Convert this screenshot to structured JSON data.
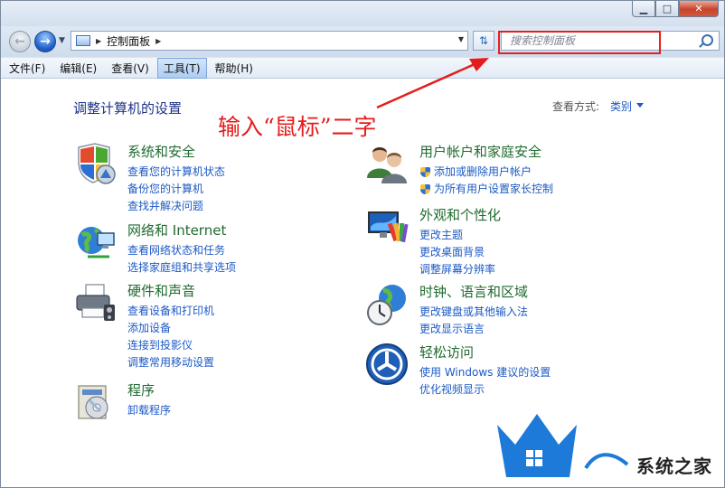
{
  "window": {
    "minimize_glyph": "▁",
    "maximize_glyph": "□",
    "close_glyph": "✕"
  },
  "address": {
    "crumb": "控制面板",
    "search_placeholder": "搜索控制面板"
  },
  "menu": {
    "items": [
      {
        "label": "文件(F)",
        "active": false
      },
      {
        "label": "编辑(E)",
        "active": false
      },
      {
        "label": "查看(V)",
        "active": false
      },
      {
        "label": "工具(T)",
        "active": true
      },
      {
        "label": "帮助(H)",
        "active": false
      }
    ]
  },
  "content": {
    "title": "调整计算机的设置",
    "view_by_label": "查看方式:",
    "view_by_value": "类别",
    "annotation": "输入“鼠标”二字"
  },
  "categories": {
    "system": {
      "icon": "shield-icon",
      "title": "系统和安全",
      "links": [
        "查看您的计算机状态",
        "备份您的计算机",
        "查找并解决问题"
      ]
    },
    "network": {
      "icon": "network-globe-icon",
      "title": "网络和 Internet",
      "links": [
        "查看网络状态和任务",
        "选择家庭组和共享选项"
      ]
    },
    "hardware": {
      "icon": "printer-icon",
      "title": "硬件和声音",
      "links": [
        "查看设备和打印机",
        "添加设备",
        "连接到投影仪",
        "调整常用移动设置"
      ]
    },
    "programs": {
      "icon": "programs-icon",
      "title": "程序",
      "links": [
        "卸载程序"
      ]
    },
    "users": {
      "icon": "users-icon",
      "title": "用户帐户和家庭安全",
      "links": [
        "添加或删除用户帐户",
        "为所有用户设置家长控制"
      ]
    },
    "appearance": {
      "icon": "display-icon",
      "title": "外观和个性化",
      "links": [
        "更改主题",
        "更改桌面背景",
        "调整屏幕分辨率"
      ]
    },
    "clock": {
      "icon": "clock-globe-icon",
      "title": "时钟、语言和区域",
      "links": [
        "更改键盘或其他输入法",
        "更改显示语言"
      ]
    },
    "ease": {
      "icon": "ease-of-access-icon",
      "title": "轻松访问",
      "links": [
        "使用 Windows 建议的设置",
        "优化视频显示"
      ]
    }
  },
  "watermark": {
    "text": "系统之家"
  },
  "colors": {
    "link": "#1c5ac5",
    "category_title": "#1f6b2f",
    "annotation_red": "#e51c1c"
  }
}
